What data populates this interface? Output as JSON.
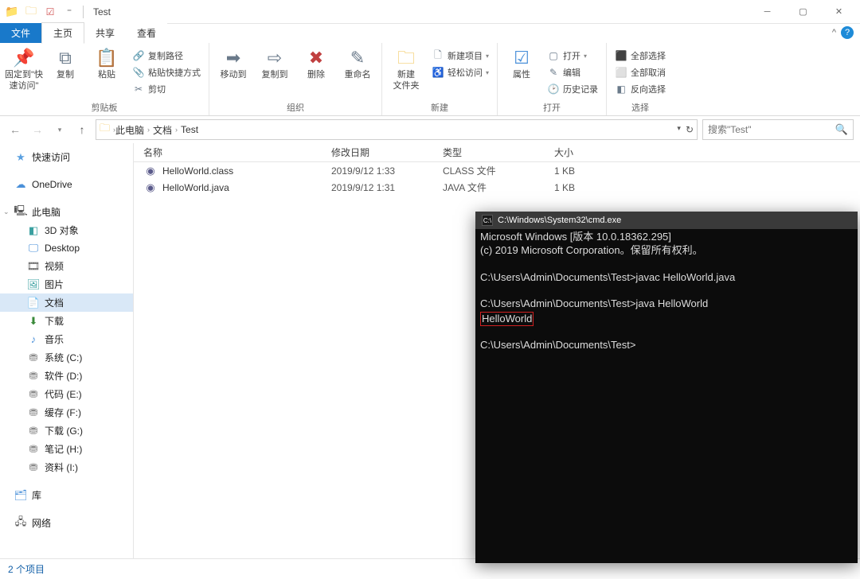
{
  "window": {
    "title": "Test"
  },
  "tabs": {
    "file": "文件",
    "home": "主页",
    "share": "共享",
    "view": "查看"
  },
  "ribbon": {
    "pin": "固定到\"快\n速访问\"",
    "copy": "复制",
    "paste": "粘贴",
    "copypath": "复制路径",
    "pasteshortcut": "粘贴快捷方式",
    "cut": "剪切",
    "clipboard": "剪贴板",
    "moveto": "移动到",
    "copyto": "复制到",
    "delete": "删除",
    "rename": "重命名",
    "organize": "组织",
    "newfolder": "新建\n文件夹",
    "newitem": "新建项目",
    "easyaccess": "轻松访问",
    "new": "新建",
    "properties": "属性",
    "open": "打开",
    "edit": "编辑",
    "history": "历史记录",
    "opengroup": "打开",
    "selectall": "全部选择",
    "selectnone": "全部取消",
    "invertsel": "反向选择",
    "select": "选择"
  },
  "breadcrumb": {
    "pc": "此电脑",
    "docs": "文档",
    "test": "Test"
  },
  "search": {
    "placeholder": "搜索\"Test\""
  },
  "columns": {
    "name": "名称",
    "date": "修改日期",
    "type": "类型",
    "size": "大小"
  },
  "sidebar": {
    "quick": "快速访问",
    "onedrive": "OneDrive",
    "pc": "此电脑",
    "items": [
      "3D 对象",
      "Desktop",
      "视频",
      "图片",
      "文档",
      "下载",
      "音乐",
      "系统 (C:)",
      "软件 (D:)",
      "代码 (E:)",
      "缓存 (F:)",
      "下载 (G:)",
      "笔记 (H:)",
      "资料 (I:)"
    ],
    "lib": "库",
    "net": "网络"
  },
  "files": [
    {
      "name": "HelloWorld.class",
      "date": "2019/9/12 1:33",
      "type": "CLASS 文件",
      "size": "1 KB"
    },
    {
      "name": "HelloWorld.java",
      "date": "2019/9/12 1:31",
      "type": "JAVA 文件",
      "size": "1 KB"
    }
  ],
  "status": "2 个项目",
  "cmd": {
    "title": "C:\\Windows\\System32\\cmd.exe",
    "l1": "Microsoft Windows [版本 10.0.18362.295]",
    "l2": "(c) 2019 Microsoft Corporation。保留所有权利。",
    "p1": "C:\\Users\\Admin\\Documents\\Test>javac HelloWorld.java",
    "p2": "C:\\Users\\Admin\\Documents\\Test>java HelloWorld",
    "out": "HelloWorld",
    "p3": "C:\\Users\\Admin\\Documents\\Test>"
  }
}
